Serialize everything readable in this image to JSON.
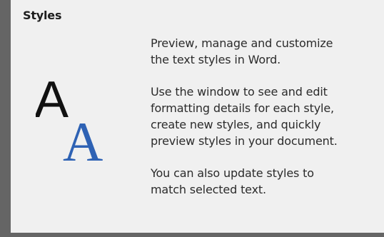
{
  "tooltip": {
    "title": "Styles",
    "paragraphs": [
      [
        "Preview, manage and customize",
        "the text styles in Word."
      ],
      [
        "Use the window to see and edit",
        "formatting details for each style,",
        "create new styles, and quickly",
        "preview styles in your document."
      ],
      [
        "You can also update styles to",
        "match selected text."
      ]
    ],
    "icon": {
      "name": "styles-aa-icon",
      "big_letter": "A",
      "small_letter": "A",
      "dark_color": "#111111",
      "blue_color": "#2e62b4"
    }
  }
}
